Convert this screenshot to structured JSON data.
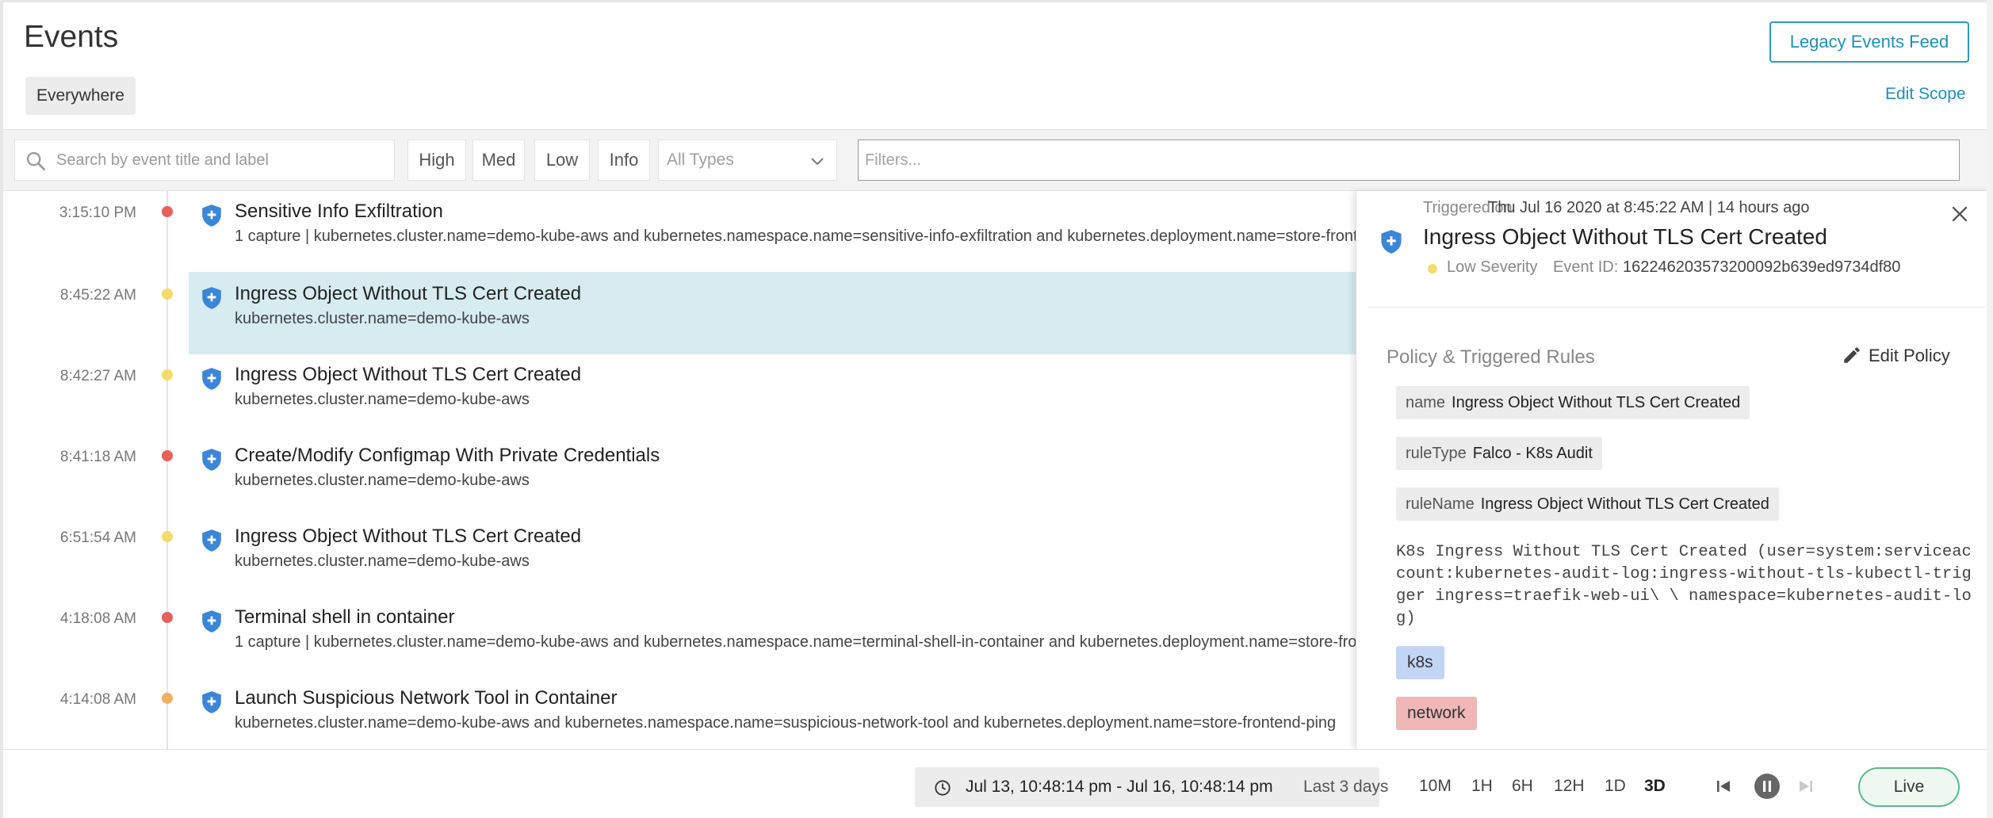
{
  "header": {
    "title": "Events",
    "scope_chip": "Everywhere",
    "legacy_button": "Legacy Events Feed",
    "edit_scope": "Edit Scope"
  },
  "filters": {
    "search_placeholder": "Search by event title and label",
    "severity_buttons": [
      "High",
      "Med",
      "Low",
      "Info"
    ],
    "type_select": "All Types",
    "filters_placeholder": "Filters..."
  },
  "colors": {
    "accent": "#1f8fb6",
    "sev_high": "#e8605a",
    "sev_low": "#f2dc6b",
    "sev_medium": "#f3b063",
    "shield": "#3b86d6",
    "selected_row": "#d6ecf0",
    "tag_k8s": "#c2d5f5",
    "tag_network": "#efb7b7",
    "live_border": "#5ab88a"
  },
  "events": [
    {
      "time": "3:15:10 PM",
      "severity_color": "#e8605a",
      "title": "Sensitive Info Exfiltration",
      "subtitle": "1 capture | kubernetes.cluster.name=demo-kube-aws and kubernetes.namespace.name=sensitive-info-exfiltration and kubernetes.deployment.name=store-frontend",
      "selected": false
    },
    {
      "time": "8:45:22 AM",
      "severity_color": "#f2dc6b",
      "title": "Ingress Object Without TLS Cert Created",
      "subtitle": "kubernetes.cluster.name=demo-kube-aws",
      "selected": true
    },
    {
      "time": "8:42:27 AM",
      "severity_color": "#f2dc6b",
      "title": "Ingress Object Without TLS Cert Created",
      "subtitle": "kubernetes.cluster.name=demo-kube-aws",
      "selected": false
    },
    {
      "time": "8:41:18 AM",
      "severity_color": "#e8605a",
      "title": "Create/Modify Configmap With Private Credentials",
      "subtitle": "kubernetes.cluster.name=demo-kube-aws",
      "selected": false
    },
    {
      "time": "6:51:54 AM",
      "severity_color": "#f2dc6b",
      "title": "Ingress Object Without TLS Cert Created",
      "subtitle": "kubernetes.cluster.name=demo-kube-aws",
      "selected": false
    },
    {
      "time": "4:18:08 AM",
      "severity_color": "#e8605a",
      "title": "Terminal shell in container",
      "subtitle": "1 capture | kubernetes.cluster.name=demo-kube-aws and kubernetes.namespace.name=terminal-shell-in-container and kubernetes.deployment.name=store-frontend",
      "selected": false
    },
    {
      "time": "4:14:08 AM",
      "severity_color": "#f3b063",
      "title": "Launch Suspicious Network Tool in Container",
      "subtitle": "kubernetes.cluster.name=demo-kube-aws and kubernetes.namespace.name=suspicious-network-tool and kubernetes.deployment.name=store-frontend-ping",
      "selected": false
    }
  ],
  "detail": {
    "triggered_label": "Triggered on",
    "triggered_value": "Thu Jul 16 2020 at 8:45:22 AM | 14 hours ago",
    "title": "Ingress Object Without TLS Cert Created",
    "severity": "Low Severity",
    "event_id_label": "Event ID:",
    "event_id": "162246203573200092b639ed9734df80",
    "section_title": "Policy & Triggered Rules",
    "edit_policy": "Edit Policy",
    "rules": [
      {
        "key": "name",
        "value": "Ingress Object Without TLS Cert Created"
      },
      {
        "key": "ruleType",
        "value": "Falco - K8s Audit"
      },
      {
        "key": "ruleName",
        "value": "Ingress Object Without TLS Cert Created"
      }
    ],
    "output": "K8s Ingress Without TLS Cert Created (user=system:serviceaccount:kubernetes-audit-log:ingress-without-tls-kubectl-trigger ingress=traefik-web-ui\\ \\ namespace=kubernetes-audit-log)",
    "tags": [
      "k8s",
      "network"
    ]
  },
  "timebar": {
    "range": "Jul 13, 10:48:14 pm - Jul 16, 10:48:14 pm",
    "relative": "Last 3 days",
    "quick_ranges": [
      "10M",
      "1H",
      "6H",
      "12H",
      "1D",
      "3D"
    ],
    "active_range": "3D",
    "live": "Live"
  }
}
